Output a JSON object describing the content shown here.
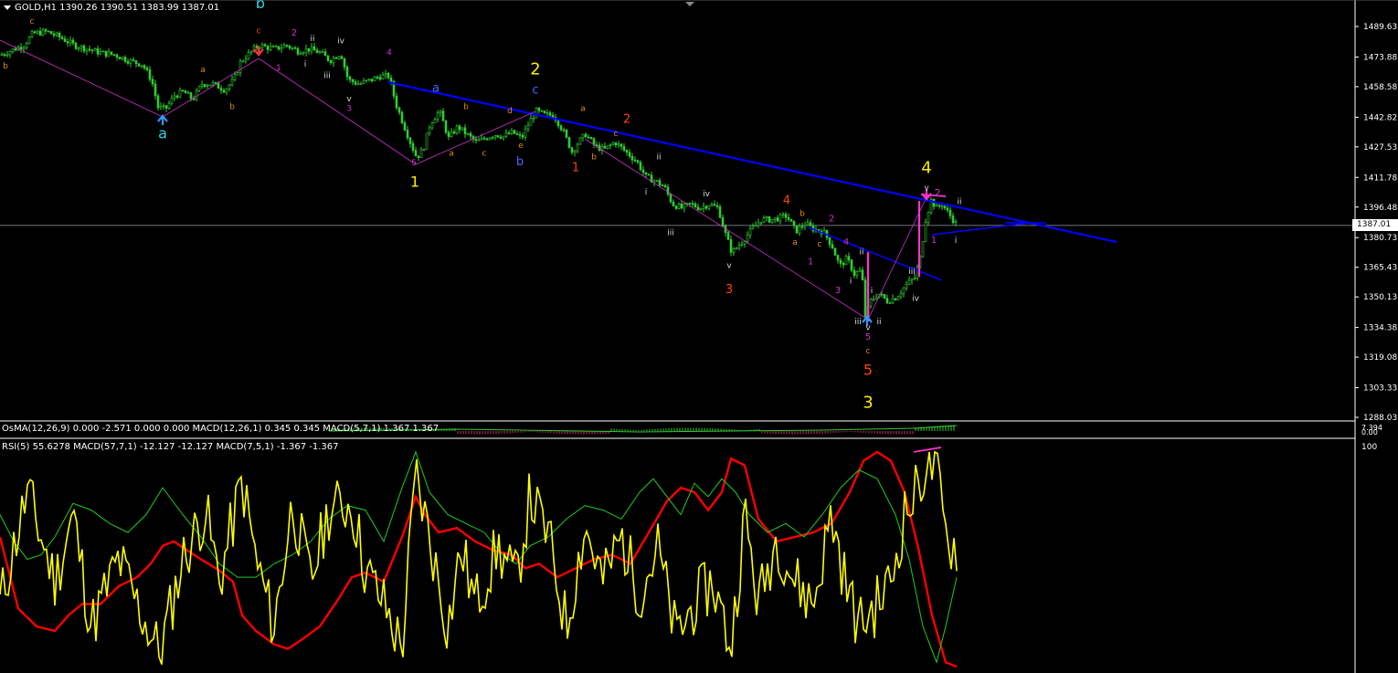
{
  "header": {
    "symbol": "GOLD,H1",
    "open": "1390.26",
    "high": "1390.51",
    "low": "1383.99",
    "close": "1387.01"
  },
  "osma_header": "OsMA(12,26,9) 0.000 -2.571 0.000 0.000  MACD(12,26,1) 0.345 0.345  MACD(5,7,1) 1.367 1.367",
  "rsi_header": "RSI(5) 55.6278  MACD(57,7,1) -12.127 -12.127  MACD(7,5,1) -1.367 -1.367",
  "current_price": "1387.01",
  "osma_scale": [
    "7.394",
    "0.00"
  ],
  "rsi_scale": [
    "100"
  ],
  "colors": {
    "background": "#000000",
    "candle": "#33cc33",
    "trendline": "#0000ff",
    "channel": "#cc33cc",
    "rsi": "#ffff00",
    "macd_slow": "#ff0000",
    "macd_fast": "#22cc22",
    "wave_primary": "#ffee00",
    "wave_intermediate": "#ff4400",
    "wave_minor": "#cc33cc",
    "wave_minute": "#dddddd",
    "wave_abc": "#2ad4e8",
    "wave_sub": "#e08a1e",
    "wave_blue": "#4466ff"
  },
  "chart_data": [
    {
      "type": "candlestick",
      "symbol": "GOLD",
      "timeframe": "H1",
      "ylim": [
        1288.03,
        1497.5
      ],
      "y_ticks": [
        "1489.63",
        "1473.88",
        "1458.58",
        "1442.82",
        "1427.53",
        "1411.78",
        "1396.48",
        "1380.73",
        "1365.43",
        "1350.13",
        "1334.38",
        "1319.08",
        "1303.33",
        "1288.03"
      ],
      "close_path": [
        [
          0,
          1475
        ],
        [
          15,
          1478
        ],
        [
          25,
          1480
        ],
        [
          35,
          1486
        ],
        [
          50,
          1487
        ],
        [
          65,
          1484
        ],
        [
          80,
          1480
        ],
        [
          95,
          1478
        ],
        [
          110,
          1476
        ],
        [
          125,
          1475
        ],
        [
          140,
          1472
        ],
        [
          155,
          1470
        ],
        [
          165,
          1462
        ],
        [
          172,
          1448
        ],
        [
          180,
          1447
        ],
        [
          190,
          1454
        ],
        [
          200,
          1456
        ],
        [
          210,
          1452
        ],
        [
          220,
          1460
        ],
        [
          232,
          1460
        ],
        [
          245,
          1457
        ],
        [
          255,
          1462
        ],
        [
          262,
          1471
        ],
        [
          270,
          1475
        ],
        [
          282,
          1480
        ],
        [
          290,
          1479
        ],
        [
          300,
          1478
        ],
        [
          312,
          1480
        ],
        [
          325,
          1477
        ],
        [
          338,
          1478
        ],
        [
          350,
          1476
        ],
        [
          360,
          1472
        ],
        [
          372,
          1476
        ],
        [
          380,
          1462
        ],
        [
          392,
          1460
        ],
        [
          405,
          1462
        ],
        [
          415,
          1464
        ],
        [
          425,
          1464
        ],
        [
          432,
          1450
        ],
        [
          440,
          1440
        ],
        [
          448,
          1430
        ],
        [
          455,
          1422
        ],
        [
          462,
          1426
        ],
        [
          470,
          1440
        ],
        [
          480,
          1446
        ],
        [
          490,
          1432
        ],
        [
          500,
          1438
        ],
        [
          510,
          1434
        ],
        [
          520,
          1430
        ],
        [
          530,
          1432
        ],
        [
          540,
          1434
        ],
        [
          550,
          1433
        ],
        [
          560,
          1435
        ],
        [
          570,
          1432
        ],
        [
          578,
          1440
        ],
        [
          586,
          1446
        ],
        [
          595,
          1444
        ],
        [
          605,
          1444
        ],
        [
          615,
          1436
        ],
        [
          625,
          1425
        ],
        [
          632,
          1430
        ],
        [
          640,
          1434
        ],
        [
          650,
          1428
        ],
        [
          660,
          1426
        ],
        [
          672,
          1430
        ],
        [
          684,
          1425
        ],
        [
          696,
          1420
        ],
        [
          706,
          1412
        ],
        [
          716,
          1410
        ],
        [
          726,
          1407
        ],
        [
          735,
          1398
        ],
        [
          745,
          1396
        ],
        [
          755,
          1398
        ],
        [
          765,
          1396
        ],
        [
          775,
          1398
        ],
        [
          785,
          1396
        ],
        [
          792,
          1384
        ],
        [
          800,
          1373
        ],
        [
          810,
          1378
        ],
        [
          820,
          1384
        ],
        [
          832,
          1390
        ],
        [
          845,
          1390
        ],
        [
          860,
          1392
        ],
        [
          870,
          1384
        ],
        [
          880,
          1388
        ],
        [
          890,
          1385
        ],
        [
          900,
          1384
        ],
        [
          910,
          1376
        ],
        [
          918,
          1366
        ],
        [
          926,
          1370
        ],
        [
          934,
          1362
        ],
        [
          942,
          1364
        ],
        [
          946,
          1340
        ],
        [
          952,
          1348
        ],
        [
          960,
          1352
        ],
        [
          970,
          1348
        ],
        [
          980,
          1350
        ],
        [
          990,
          1356
        ],
        [
          1000,
          1360
        ],
        [
          1006,
          1370
        ],
        [
          1012,
          1390
        ],
        [
          1018,
          1400
        ],
        [
          1024,
          1396
        ],
        [
          1030,
          1398
        ],
        [
          1036,
          1394
        ],
        [
          1042,
          1390
        ],
        [
          1047,
          1387.01
        ]
      ]
    },
    {
      "type": "line",
      "name": "RSI / MACD",
      "ylim": [
        0,
        100
      ],
      "series": [
        {
          "name": "RSI(5)",
          "color": "#ffff00"
        },
        {
          "name": "MACD(57,7,1)",
          "color": "#ff0000"
        },
        {
          "name": "MACD(7,5,1)",
          "color": "#22cc22"
        }
      ]
    }
  ],
  "wave_labels": [
    {
      "text": "c",
      "color": "wave_sub",
      "price": 1491
    },
    {
      "text": "b",
      "color": "wave_sub",
      "price": 1468
    },
    {
      "text": "a",
      "color": "wave_abc",
      "price": 1432
    },
    {
      "text": "b",
      "color": "wave_abc",
      "price": 1499
    },
    {
      "text": "a",
      "color": "wave_sub",
      "price": 1466
    },
    {
      "text": "b",
      "color": "wave_sub",
      "price": 1447
    },
    {
      "text": "c",
      "color": "wave_intermediate",
      "price": 1486
    },
    {
      "text": "1",
      "color": "wave_minor",
      "price": 1467
    },
    {
      "text": "2",
      "color": "wave_minor",
      "price": 1485
    },
    {
      "text": "i",
      "color": "wave_minute",
      "price": 1469
    },
    {
      "text": "ii",
      "color": "wave_minute",
      "price": 1482
    },
    {
      "text": "iii",
      "color": "wave_minute",
      "price": 1463
    },
    {
      "text": "iv",
      "color": "wave_minute",
      "price": 1481
    },
    {
      "text": "v",
      "color": "wave_minute",
      "price": 1451
    },
    {
      "text": "3",
      "color": "wave_minor",
      "price": 1446
    },
    {
      "text": "4",
      "color": "wave_minor",
      "price": 1475
    },
    {
      "text": "5",
      "color": "wave_minor",
      "price": 1418
    },
    {
      "text": "1",
      "color": "wave_primary",
      "price": 1407
    },
    {
      "text": "a",
      "color": "wave_blue",
      "price": 1456
    },
    {
      "text": "a",
      "color": "wave_sub",
      "price": 1423
    },
    {
      "text": "b",
      "color": "wave_sub",
      "price": 1447
    },
    {
      "text": "c",
      "color": "wave_sub",
      "price": 1423
    },
    {
      "text": "d",
      "color": "wave_sub",
      "price": 1445
    },
    {
      "text": "e",
      "color": "wave_sub",
      "price": 1427
    },
    {
      "text": "b",
      "color": "wave_blue",
      "price": 1418
    },
    {
      "text": "2",
      "color": "wave_primary",
      "price": 1465
    },
    {
      "text": "c",
      "color": "wave_blue",
      "price": 1455
    },
    {
      "text": "a",
      "color": "wave_sub",
      "price": 1446
    },
    {
      "text": "b",
      "color": "wave_sub",
      "price": 1421
    },
    {
      "text": "1",
      "color": "wave_intermediate",
      "price": 1415
    },
    {
      "text": "2",
      "color": "wave_intermediate",
      "price": 1440
    },
    {
      "text": "c",
      "color": "wave_sub",
      "price": 1433
    },
    {
      "text": "ii",
      "color": "wave_minute",
      "price": 1421
    },
    {
      "text": "i",
      "color": "wave_minute",
      "price": 1403
    },
    {
      "text": "iii",
      "color": "wave_minute",
      "price": 1382
    },
    {
      "text": "iv",
      "color": "wave_minute",
      "price": 1402
    },
    {
      "text": "v",
      "color": "wave_minute",
      "price": 1365
    },
    {
      "text": "3",
      "color": "wave_intermediate",
      "price": 1352
    },
    {
      "text": "4",
      "color": "wave_intermediate",
      "price": 1398
    },
    {
      "text": "b",
      "color": "wave_sub",
      "price": 1392
    },
    {
      "text": "a",
      "color": "wave_sub",
      "price": 1377
    },
    {
      "text": "2",
      "color": "wave_minor",
      "price": 1389
    },
    {
      "text": "c",
      "color": "wave_sub",
      "price": 1376
    },
    {
      "text": "1",
      "color": "wave_minor",
      "price": 1367
    },
    {
      "text": "4",
      "color": "wave_minor",
      "price": 1377
    },
    {
      "text": "3",
      "color": "wave_minor",
      "price": 1352
    },
    {
      "text": "i",
      "color": "wave_minute",
      "price": 1352
    },
    {
      "text": "ii",
      "color": "wave_minute",
      "price": 1372
    },
    {
      "text": "i",
      "color": "wave_minute",
      "price": 1357
    },
    {
      "text": "iii",
      "color": "wave_minute",
      "price": 1336
    },
    {
      "text": "v",
      "color": "wave_minute",
      "price": 1333
    },
    {
      "text": "ii",
      "color": "wave_minute",
      "price": 1336
    },
    {
      "text": "5",
      "color": "wave_minor",
      "price": 1328
    },
    {
      "text": "c",
      "color": "wave_sub",
      "price": 1321
    },
    {
      "text": "5",
      "color": "wave_intermediate",
      "price": 1310
    },
    {
      "text": "3",
      "color": "wave_primary",
      "price": 1293
    },
    {
      "text": "iii",
      "color": "wave_minute",
      "price": 1362
    },
    {
      "text": "iv",
      "color": "wave_minute",
      "price": 1348
    },
    {
      "text": "4",
      "color": "wave_primary",
      "price": 1414
    },
    {
      "text": "v",
      "color": "wave_minute",
      "price": 1405
    },
    {
      "text": "2",
      "color": "wave_minor",
      "price": 1402
    },
    {
      "text": "ii",
      "color": "wave_minute",
      "price": 1398
    },
    {
      "text": "1",
      "color": "wave_minor",
      "price": 1378
    },
    {
      "text": "i",
      "color": "wave_minute",
      "price": 1378
    }
  ]
}
